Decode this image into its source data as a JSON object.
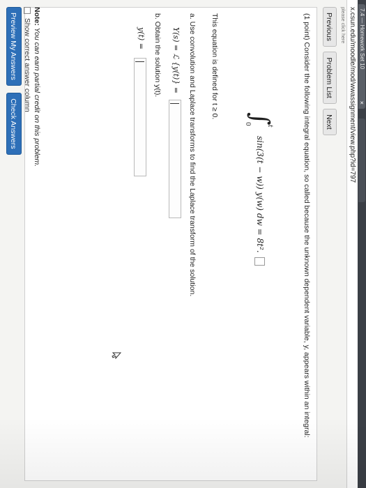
{
  "browser": {
    "tab_title": "7.4 — Homework Set 10",
    "tab_close": "×",
    "url": "x.csun.edu/moodle/mod/wwassignment/view.php?id=797"
  },
  "breadcrumb": "please click here",
  "nav": {
    "previous": "Previous",
    "problem_list": "Problem List",
    "next": "Next"
  },
  "problem": {
    "intro": "(1 point) Consider the following integral equation, so called because the unknown dependent variable, y, appears within an integral:",
    "equation": {
      "integral_sign": "∫",
      "upper_limit": "t",
      "lower_limit": "0",
      "integrand": "sin(3(t − w)) y(w) dw = 8t²."
    },
    "domain_text": "This equation is defined for t ≥ 0.",
    "part_a": {
      "prompt": "a. Use convolution and Laplace transforms to find the Laplace transform of the solution.",
      "answer_label": "Y(s) = ℒ {y(t)} =",
      "answer_value": ""
    },
    "part_b": {
      "prompt": "b. Obtain the solution y(t).",
      "answer_label": "y(t) =",
      "answer_value": ""
    }
  },
  "note": {
    "label": "Note:",
    "text": "You can earn partial credit on this problem."
  },
  "show_correct": "Show correct answer column",
  "buttons": {
    "preview": "Preview My Answers",
    "check": "Check Answers"
  },
  "colors": {
    "submit_button": "#2d6fb8",
    "nav_button": "#e7e7e7"
  }
}
